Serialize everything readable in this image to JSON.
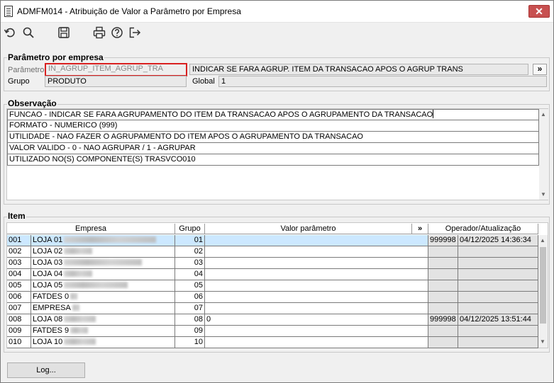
{
  "window": {
    "title": "ADMFM014 - Atribuição de Valor a Parâmetro por Empresa",
    "close_label": "✕"
  },
  "toolbar": {
    "icons": [
      "undo-icon",
      "search-icon",
      "save-icon",
      "print-icon",
      "help-icon",
      "exit-icon"
    ]
  },
  "param": {
    "legend": "Parâmetro por empresa",
    "parametro_label": "Parâmetro",
    "parametro_value": "IN_AGRUP_ITEM_AGRUP_TRA",
    "description": "INDICAR SE FARA AGRUP. ITEM DA TRANSACAO APOS O AGRUP TRANS",
    "more_label": "»",
    "grupo_label": "Grupo",
    "grupo_value": "PRODUTO",
    "global_label": "Global",
    "global_value": "1"
  },
  "obs": {
    "legend": "Observação",
    "lines": [
      "FUNCAO - INDICAR SE FARA AGRUPAMENTO DO ITEM DA TRANSACAO APOS O AGRUPAMENTO DA TRANSACAO",
      "FORMATO - NUMERICO (999)",
      "UTILIDADE - NAO FAZER O AGRUPAMENTO DO ITEM APOS O AGRUPAMENTO DA TRANSACAO",
      "VALOR VALIDO -  0 - NAO AGRUPAR / 1 - AGRUPAR",
      "UTILIZADO NO(S) COMPONENTE(S) TRASVCO010"
    ]
  },
  "item": {
    "legend": "Item",
    "headers": {
      "empresa": "Empresa",
      "grupo": "Grupo",
      "valor": "Valor parâmetro",
      "more": "»",
      "operador": "Operador/Atualização"
    },
    "rows": [
      {
        "code": "001",
        "name": "LOJA 01",
        "grupo": "01",
        "valor": "",
        "operador": "999998",
        "data": "04/12/2025 14:36:34"
      },
      {
        "code": "002",
        "name": "LOJA 02",
        "grupo": "02",
        "valor": "",
        "operador": "",
        "data": ""
      },
      {
        "code": "003",
        "name": "LOJA 03",
        "grupo": "03",
        "valor": "",
        "operador": "",
        "data": ""
      },
      {
        "code": "004",
        "name": "LOJA 04",
        "grupo": "04",
        "valor": "",
        "operador": "",
        "data": ""
      },
      {
        "code": "005",
        "name": "LOJA 05",
        "grupo": "05",
        "valor": "",
        "operador": "",
        "data": ""
      },
      {
        "code": "006",
        "name": "FATDES 0",
        "grupo": "06",
        "valor": "",
        "operador": "",
        "data": ""
      },
      {
        "code": "007",
        "name": "EMPRESA",
        "grupo": "07",
        "valor": "",
        "operador": "",
        "data": ""
      },
      {
        "code": "008",
        "name": "LOJA 08",
        "grupo": "08",
        "valor": "0",
        "operador": "999998",
        "data": "04/12/2025 13:51:44"
      },
      {
        "code": "009",
        "name": "FATDES 9",
        "grupo": "09",
        "valor": "",
        "operador": "",
        "data": ""
      },
      {
        "code": "010",
        "name": "LOJA 10",
        "grupo": "10",
        "valor": "",
        "operador": "",
        "data": ""
      }
    ]
  },
  "footer": {
    "log_label": "Log..."
  }
}
